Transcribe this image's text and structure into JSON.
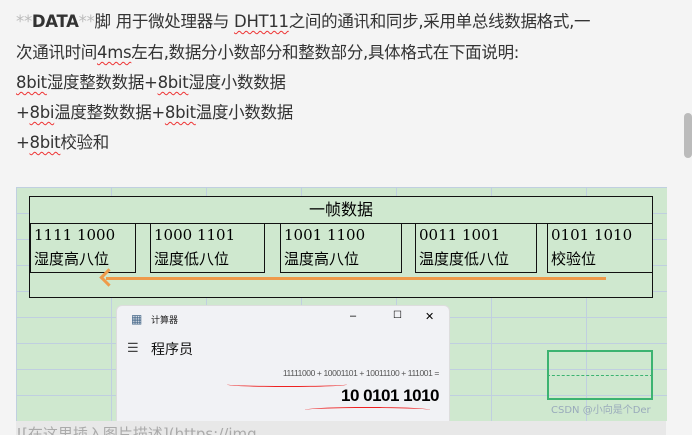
{
  "text": {
    "l1_pre": "**",
    "l1_bold": "DATA",
    "l1_post": "**",
    "l1_a": "脚 用于微处理器与 ",
    "l1_dht": "DHT11",
    "l1_b": "之间的通讯和同步,采用单总线数据格式,一",
    "l2_a": "次通讯时间",
    "l2_4ms": "4ms",
    "l2_b": "左右,数据分小数部分和整数部分,具体格式在下面说明:",
    "l3_a": "8bit",
    "l3_b": "湿度整数数据+",
    "l3_c": "8bit",
    "l3_d": "湿度小数数据",
    "l4_a": "+",
    "l4_b": "8bi",
    "l4_c": "温度整数数据+",
    "l4_d": "8bit",
    "l4_e": "温度小数数据",
    "l5_a": "+",
    "l5_b": "8bit",
    "l5_c": "校验和"
  },
  "figure": {
    "header": "一帧数据",
    "cells": [
      {
        "bits": "1111  1000",
        "label": "湿度高八位"
      },
      {
        "bits": "1000  1101",
        "label": "湿度低八位"
      },
      {
        "bits": "1001  1100",
        "label": "温度高八位"
      },
      {
        "bits": "0011  1001",
        "label": "温度度低八位"
      },
      {
        "bits": "0101  1010",
        "label": "校验位"
      }
    ],
    "calculator": {
      "title": "计算器",
      "minimize": "–",
      "maximize": "☐",
      "close": "✕",
      "menu": "☰",
      "mode": "程序员",
      "expression": "11111000 + 10001101 + 10011100 + 111001 =",
      "result": "10 0101 1010"
    },
    "watermark": "CSDN @小向是个Der"
  },
  "bottom_text": "![在这里插入图片描述](https://img"
}
